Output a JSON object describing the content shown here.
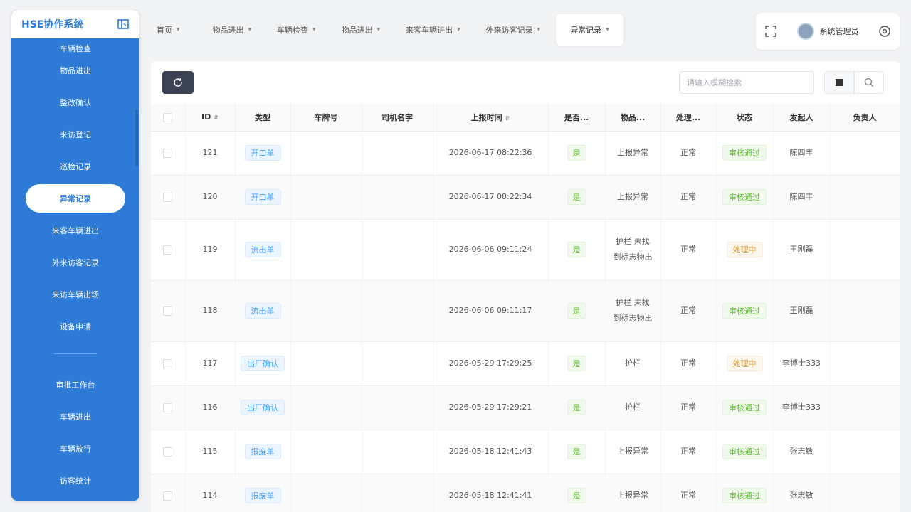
{
  "app": {
    "title": "HSE协作系统"
  },
  "sidebar": {
    "items": [
      {
        "label": "车辆检查"
      },
      {
        "label": "物品进出"
      },
      {
        "label": "整改确认"
      },
      {
        "label": "来访登记"
      },
      {
        "label": "巡检记录"
      },
      {
        "label": "异常记录"
      },
      {
        "label": "来客车辆进出"
      },
      {
        "label": "外来访客记录"
      },
      {
        "label": "来访车辆出场"
      },
      {
        "label": "设备申请"
      },
      {
        "label": "审批工作台"
      },
      {
        "label": "车辆进出"
      },
      {
        "label": "车辆放行"
      },
      {
        "label": "访客统计"
      }
    ]
  },
  "tabs": [
    {
      "label": "首页"
    },
    {
      "label": "物品进出"
    },
    {
      "label": "车辆检查"
    },
    {
      "label": "物品进出"
    },
    {
      "label": "来客车辆进出"
    },
    {
      "label": "外来访客记录"
    },
    {
      "label": "异常记录"
    }
  ],
  "user": {
    "name": "系统管理员"
  },
  "search": {
    "placeholder": "请输入模糊搜索"
  },
  "table": {
    "columns": [
      "ID",
      "类型",
      "车牌号",
      "司机名字",
      "上报时间",
      "是否...",
      "物品...",
      "处理...",
      "状态",
      "发起人",
      "负责人"
    ],
    "rows": [
      {
        "id": "121",
        "type": "开口单",
        "plate": "",
        "driver": "",
        "time": "2026-06-17 08:22:36",
        "yes": "是",
        "item": "上报异常",
        "handle": "正常",
        "status": "审核通过",
        "status_kind": "done",
        "initiator": "陈四丰",
        "owner": ""
      },
      {
        "id": "120",
        "type": "开口单",
        "plate": "",
        "driver": "",
        "time": "2026-06-17 08:22:34",
        "yes": "是",
        "item": "上报异常",
        "handle": "正常",
        "status": "审核通过",
        "status_kind": "done",
        "initiator": "陈四丰",
        "owner": ""
      },
      {
        "id": "119",
        "type": "流出单",
        "plate": "",
        "driver": "",
        "time": "2026-06-06 09:11:24",
        "yes": "是",
        "item": "护栏 未找到标志物出",
        "handle": "正常",
        "status": "处理中",
        "status_kind": "pending",
        "initiator": "王刚磊",
        "owner": ""
      },
      {
        "id": "118",
        "type": "流出单",
        "plate": "",
        "driver": "",
        "time": "2026-06-06 09:11:17",
        "yes": "是",
        "item": "护栏 未找到标志物出",
        "handle": "正常",
        "status": "审核通过",
        "status_kind": "done",
        "initiator": "王刚磊",
        "owner": ""
      },
      {
        "id": "117",
        "type": "出厂确认",
        "plate": "",
        "driver": "",
        "time": "2026-05-29 17:29:25",
        "yes": "是",
        "item": "护栏",
        "handle": "正常",
        "status": "处理中",
        "status_kind": "pending",
        "initiator": "李博士333",
        "owner": ""
      },
      {
        "id": "116",
        "type": "出厂确认",
        "plate": "",
        "driver": "",
        "time": "2026-05-29 17:29:21",
        "yes": "是",
        "item": "护栏",
        "handle": "正常",
        "status": "审核通过",
        "status_kind": "done",
        "initiator": "李博士333",
        "owner": ""
      },
      {
        "id": "115",
        "type": "报废单",
        "plate": "",
        "driver": "",
        "time": "2026-05-18 12:41:43",
        "yes": "是",
        "item": "上报异常",
        "handle": "正常",
        "status": "审核通过",
        "status_kind": "done",
        "initiator": "张志敏",
        "owner": ""
      },
      {
        "id": "114",
        "type": "报废单",
        "plate": "",
        "driver": "",
        "time": "2026-05-18 12:41:41",
        "yes": "是",
        "item": "上报异常",
        "handle": "正常",
        "status": "审核通过",
        "status_kind": "done",
        "initiator": "张志敏",
        "owner": ""
      }
    ]
  },
  "colors": {
    "primary": "#2d7bd6",
    "dark_button": "#3a4254",
    "success": "#67c23a",
    "warning": "#e6a23c"
  }
}
